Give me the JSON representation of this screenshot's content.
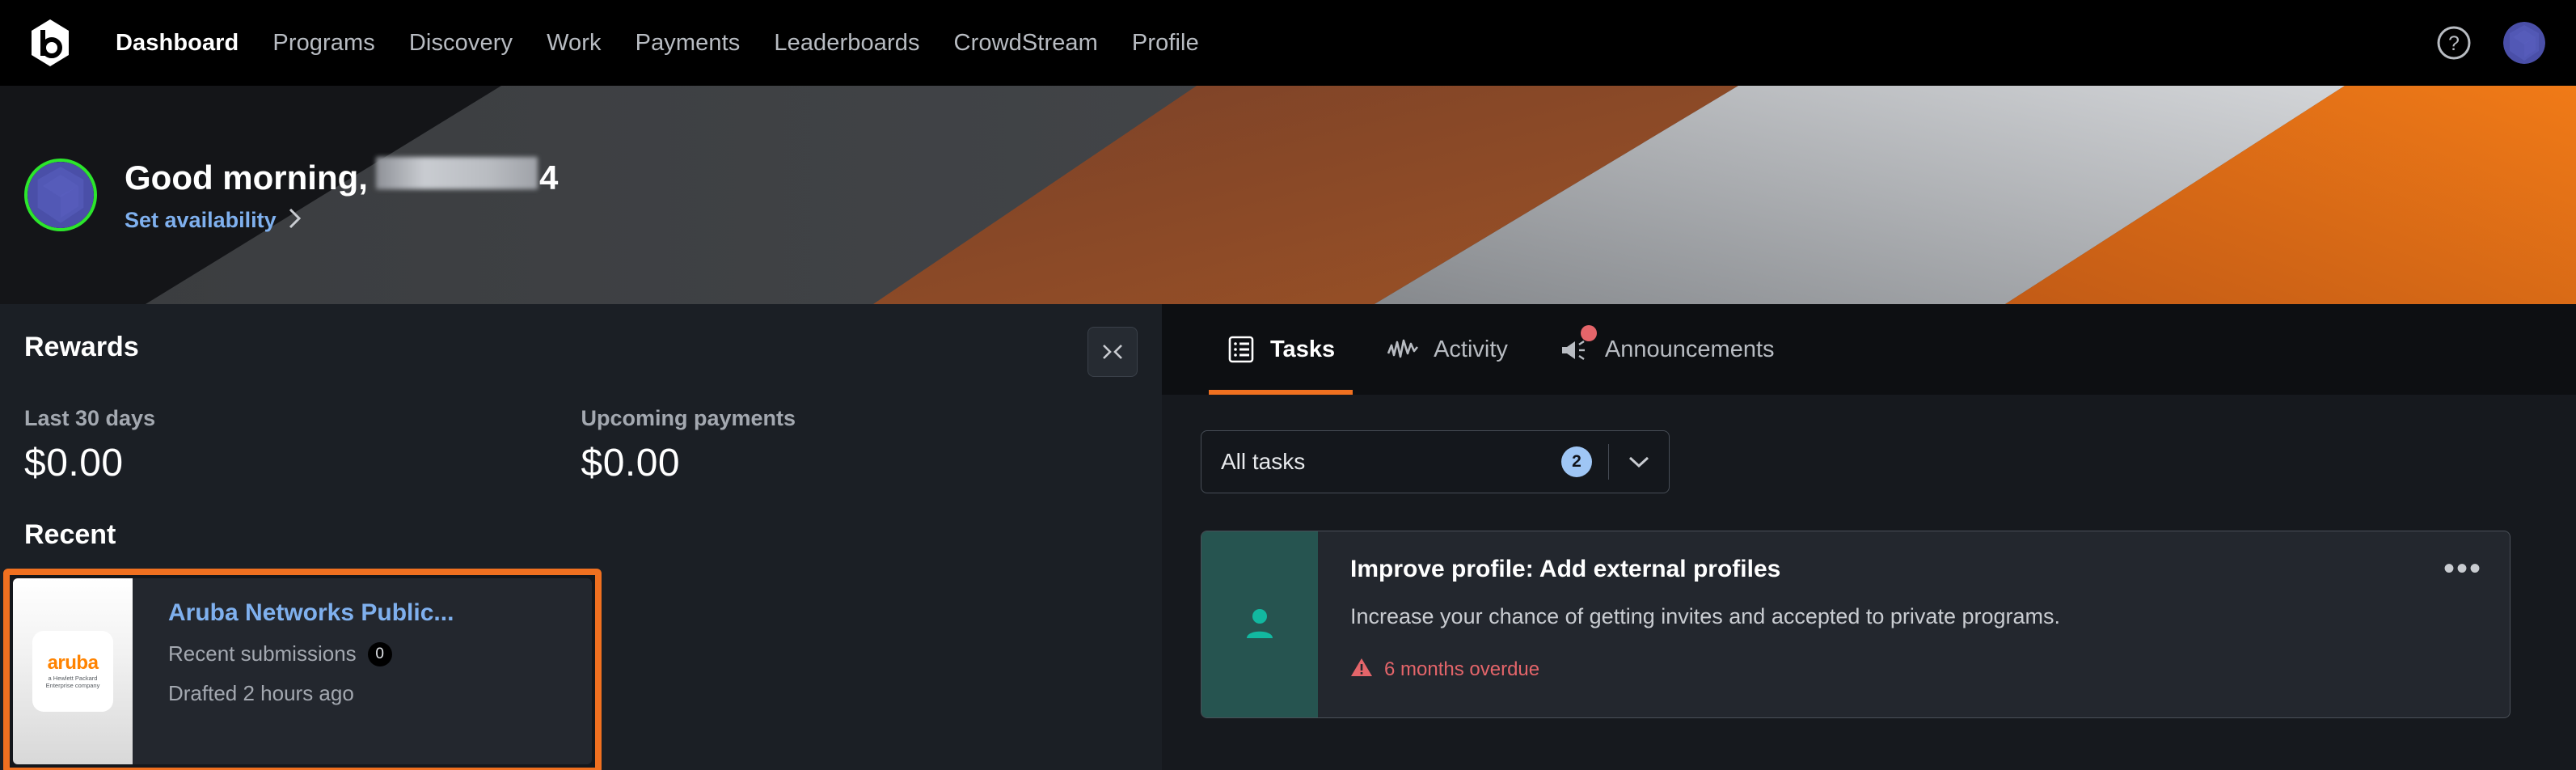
{
  "topnav": {
    "logo_icon": "bugcrowd-logo-icon",
    "links": [
      {
        "label": "Dashboard",
        "active": true
      },
      {
        "label": "Programs",
        "active": false
      },
      {
        "label": "Discovery",
        "active": false
      },
      {
        "label": "Work",
        "active": false
      },
      {
        "label": "Payments",
        "active": false
      },
      {
        "label": "Leaderboards",
        "active": false
      },
      {
        "label": "CrowdStream",
        "active": false
      },
      {
        "label": "Profile",
        "active": false
      }
    ],
    "help_icon": "help-circle-icon",
    "avatar_icon": "user-avatar"
  },
  "banner": {
    "greeting": "Good morning,",
    "name_suffix": "4",
    "name_redacted": true,
    "availability_label": "Set availability",
    "chevron_icon": "chevron-right-icon",
    "avatar_ring_color": "#2ce62c"
  },
  "left_panel": {
    "title": "Rewards",
    "collapse_icon": "collapse-panel-icon",
    "stats": [
      {
        "label": "Last 30 days",
        "value": "$0.00"
      },
      {
        "label": "Upcoming payments",
        "value": "$0.00"
      }
    ],
    "recent_title": "Recent",
    "recent_card": {
      "program_name": "Aruba Networks Public...",
      "logo_word": "aruba",
      "logo_tagline_line1": "a Hewlett Packard",
      "logo_tagline_line2": "Enterprise company",
      "submissions_label": "Recent submissions",
      "submissions_count": "0",
      "drafted": "Drafted 2 hours ago",
      "highlight_color": "#f07020"
    }
  },
  "right_panel": {
    "tabs": [
      {
        "label": "Tasks",
        "icon": "tasks-list-icon",
        "active": true,
        "badge": false
      },
      {
        "label": "Activity",
        "icon": "activity-wave-icon",
        "active": false,
        "badge": false
      },
      {
        "label": "Announcements",
        "icon": "megaphone-icon",
        "active": false,
        "badge": true
      }
    ],
    "filter": {
      "selected": "All tasks",
      "count": "2",
      "chevron_icon": "chevron-down-icon"
    },
    "tasks": [
      {
        "title": "Improve profile: Add external profiles",
        "description": "Increase your chance of getting invites and accepted to private programs.",
        "due_text": "6 months overdue",
        "due_icon": "warning-triangle-icon",
        "accent_icon": "person-icon",
        "accent_color": "#265450",
        "menu_icon": "kebab-menu-icon",
        "menu_label": "•••"
      }
    ]
  },
  "colors": {
    "accent_orange": "#f07020",
    "link_blue": "#7fb0ee",
    "danger_red": "#e4656a",
    "teal": "#12b8a0"
  }
}
